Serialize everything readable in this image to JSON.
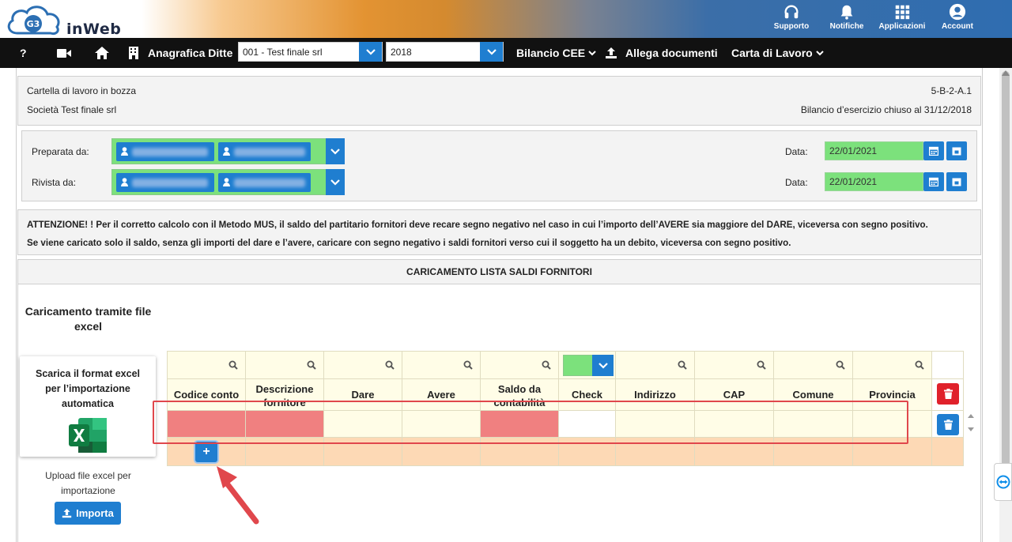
{
  "app": {
    "logo_badge": "G3",
    "logo_text": "inWeb"
  },
  "top_menu": [
    {
      "label": "Supporto",
      "icon": "headset-icon"
    },
    {
      "label": "Notifiche",
      "icon": "bell-icon"
    },
    {
      "label": "Applicazioni",
      "icon": "grid-icon"
    },
    {
      "label": "Account",
      "icon": "user-icon"
    }
  ],
  "nav": {
    "help": "?",
    "anagrafica_label": "Anagrafica Ditte",
    "company_value": "001 - Test finale srl",
    "year_value": "2018",
    "bilancio_label": "Bilancio CEE",
    "allega_label": "Allega documenti",
    "carta_label": "Carta di Lavoro"
  },
  "header": {
    "folder_status": "Cartella di lavoro in bozza",
    "code": "5-B-2-A.1",
    "company": "Società Test finale srl",
    "closing": "Bilancio d’esercizio chiuso al 31/12/2018"
  },
  "signatures": {
    "prepared_label": "Preparata da:",
    "reviewed_label": "Rivista da:",
    "date_label": "Data:",
    "prepared_date": "22/01/2021",
    "reviewed_date": "22/01/2021"
  },
  "warning": {
    "line1": "ATTENZIONE! ! Per il corretto calcolo con il Metodo MUS, il saldo del partitario fornitori deve recare segno negativo nel caso in cui l’importo dell’AVERE sia maggiore del DARE, viceversa con segno positivo.",
    "line2": "Se viene caricato solo il saldo, senza gli importi del dare e l’avere, caricare con segno negativo i saldi fornitori verso cui il soggetto ha un debito, viceversa con segno positivo."
  },
  "section": {
    "title": "CARICAMENTO LISTA SALDI FORNITORI",
    "excel_title": "Caricamento tramite file excel",
    "download_text": "Scarica il format excel per l’importazione automatica",
    "upload_text": "Upload file excel per importazione",
    "import_button": "Importa",
    "add_row_button": "+"
  },
  "columns": [
    {
      "label": "Codice conto"
    },
    {
      "label": "Descrizione fornitore"
    },
    {
      "label": "Dare"
    },
    {
      "label": "Avere"
    },
    {
      "label": "Saldo da contabilità"
    },
    {
      "label": "Check"
    },
    {
      "label": "Indirizzo"
    },
    {
      "label": "CAP"
    },
    {
      "label": "Comune"
    },
    {
      "label": "Provincia"
    }
  ],
  "colors": {
    "accent": "#1f7ed0",
    "nav_bg": "#111111",
    "valid": "#7ce17c",
    "error": "#f08080",
    "delete": "#e0212b",
    "highlight": "#e0474c"
  }
}
